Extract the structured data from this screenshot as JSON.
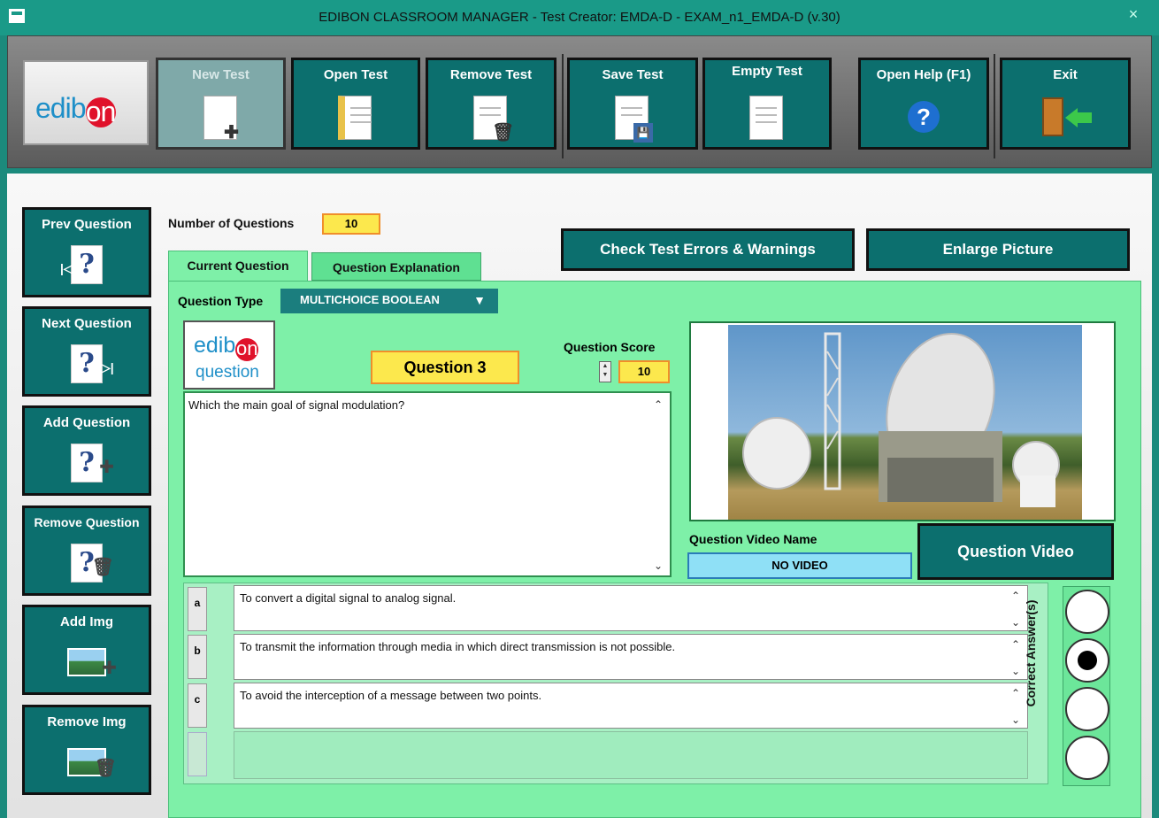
{
  "window": {
    "title": "EDIBON CLASSROOM MANAGER - Test Creator: EMDA-D - EXAM_n1_EMDA-D (v.30)",
    "close_glyph": "×"
  },
  "toolbar": {
    "logo_text": "edib",
    "logo_dot": "on",
    "buttons": [
      {
        "label": "New Test",
        "icon": "new-document-icon",
        "enabled": false
      },
      {
        "label": "Open Test",
        "icon": "open-folder-icon"
      },
      {
        "label": "Remove Test",
        "icon": "trash-document-icon"
      },
      {
        "label": "Save Test",
        "icon": "save-disk-icon"
      },
      {
        "label": "Empty Test",
        "icon": "blank-document-icon"
      },
      {
        "label": "Open Help (F1)",
        "icon": "help-icon",
        "glyph": "?"
      },
      {
        "label": "Exit",
        "icon": "exit-door-icon"
      }
    ]
  },
  "sidebar": {
    "buttons": [
      {
        "label": "Prev Question",
        "glyph": "?"
      },
      {
        "label": "Next Question",
        "glyph": "?"
      },
      {
        "label": "Add Question",
        "glyph": "?"
      },
      {
        "label": "Remove Question",
        "glyph": "?"
      },
      {
        "label": "Add Img"
      },
      {
        "label": "Remove Img"
      }
    ]
  },
  "header": {
    "num_questions_label": "Number of Questions",
    "num_questions_value": "10",
    "check_errors_label": "Check Test Errors & Warnings",
    "enlarge_picture_label": "Enlarge Picture"
  },
  "tabs": [
    {
      "label": "Current Question",
      "active": true
    },
    {
      "label": "Question Explanation",
      "active": false
    }
  ],
  "question": {
    "type_label": "Question Type",
    "type_value": "MULTICHOICE BOOLEAN",
    "logo_line1": "edib",
    "logo_dot": "on",
    "logo_line2": "question",
    "title": "Question 3",
    "score_label": "Question Score",
    "score_value": "10",
    "text": "Which the main goal of signal modulation?",
    "video_label": "Question Video Name",
    "video_name": "NO VIDEO",
    "video_button": "Question Video"
  },
  "answers": [
    {
      "letter": "a",
      "text": "To convert a digital signal to analog signal.",
      "correct": false
    },
    {
      "letter": "b",
      "text": "To transmit the information through media in which direct transmission is not possible.",
      "correct": true
    },
    {
      "letter": "c",
      "text": "To avoid the interception of a message between two points.",
      "correct": false
    },
    {
      "letter": "",
      "text": "",
      "correct": false
    }
  ],
  "correct_answers_label": "Correct Answer(s)",
  "colors": {
    "titlebar": "#1a9a88",
    "button_teal": "#0c6f6e",
    "panel_green": "#7ef0a8",
    "highlight_yellow": "#fce84d",
    "highlight_orange": "#f08e2a",
    "logo_red": "#e0122b",
    "logo_blue": "#1e8fc8"
  }
}
